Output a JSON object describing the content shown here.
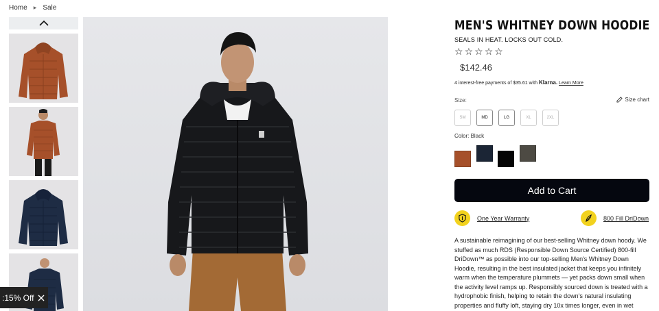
{
  "breadcrumb": {
    "home": "Home",
    "sale": "Sale"
  },
  "promo": {
    "label": ":15% Off"
  },
  "product": {
    "title": "MEN'S WHITNEY DOWN HOODIE",
    "tagline": "SEALS IN HEAT. LOCKS OUT COLD.",
    "rating": 0,
    "price": "$142.46",
    "klarna": {
      "text": "4 interest-free payments of $35.61 with",
      "brand": "Klarna.",
      "link": "Learn More"
    },
    "size_label": "Size:",
    "size_chart": "Size chart",
    "sizes": [
      "SM",
      "MD",
      "LG",
      "XL",
      "2XL"
    ],
    "sizes_available": [
      false,
      true,
      true,
      false,
      false
    ],
    "color_label": "Color:",
    "color_value": "Black",
    "colors": [
      "#a6502a",
      "#1b2535",
      "#050505",
      "#4d4a43"
    ],
    "add_to_cart": "Add to Cart",
    "warranty": "One Year Warranty",
    "fill": "800 Fill DriDown",
    "description": "A sustainable reimagining of our best-selling Whitney down hoody. We stuffed as much RDS (Responsible Down Source Certified) 800-fill DriDown™ as possible into our top-selling Men's Whitney Down Hoodie, resulting in the best insulated jacket that keeps you infinitely warm when the temperature plummets — yet packs down small when the activity level ramps up. Responsibly sourced down is treated with a hydrophobic finish, helping to retain the down's natural insulating properties and fluffy loft, staying dry 10x times longer, even in wet weather. We added details"
  },
  "icons": [
    "chevron-up-icon",
    "close-icon",
    "star-icon",
    "pencil-icon",
    "warranty-icon",
    "feather-icon"
  ]
}
